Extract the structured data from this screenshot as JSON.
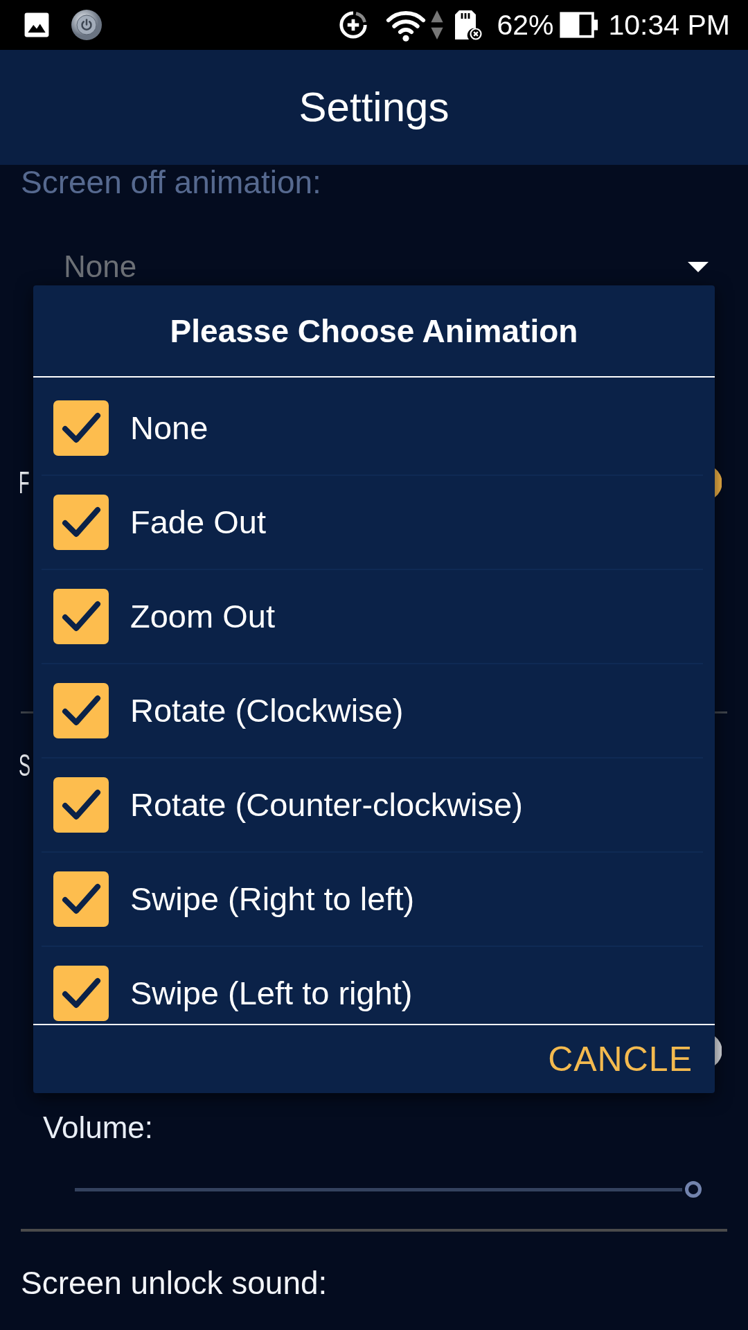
{
  "status_bar": {
    "battery": "62%",
    "time": "10:34 PM"
  },
  "app_bar": {
    "title": "Settings"
  },
  "settings": {
    "screen_off_animation": {
      "label": "Screen off animation:",
      "value": "None"
    },
    "switch_1": {
      "label": "F",
      "on": true
    },
    "section_label": "S",
    "switch_2": {
      "on": false
    },
    "volume": {
      "label": "Volume:",
      "level": 1
    },
    "screen_unlock_sound": {
      "label": "Screen unlock sound:"
    }
  },
  "dialog": {
    "title": "Pleasse Choose Animation",
    "options": [
      {
        "label": "None",
        "checked": true
      },
      {
        "label": "Fade Out",
        "checked": true
      },
      {
        "label": "Zoom Out",
        "checked": true
      },
      {
        "label": "Rotate (Clockwise)",
        "checked": true
      },
      {
        "label": "Rotate (Counter-clockwise)",
        "checked": true
      },
      {
        "label": "Swipe (Right to left)",
        "checked": true
      },
      {
        "label": "Swipe (Left to right)",
        "checked": true
      }
    ],
    "cancel_button": "CANCLE"
  }
}
